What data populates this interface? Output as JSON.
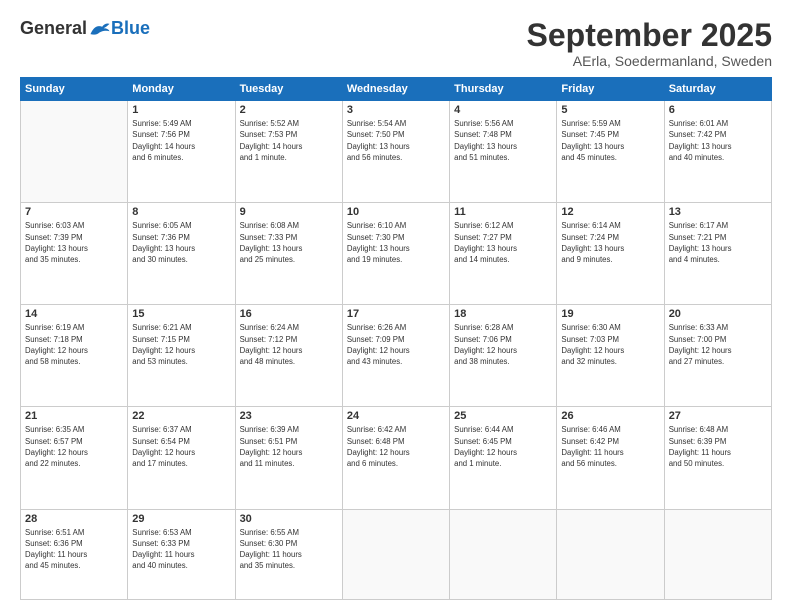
{
  "logo": {
    "general": "General",
    "blue": "Blue"
  },
  "header": {
    "month": "September 2025",
    "location": "AErla, Soedermanland, Sweden"
  },
  "days_of_week": [
    "Sunday",
    "Monday",
    "Tuesday",
    "Wednesday",
    "Thursday",
    "Friday",
    "Saturday"
  ],
  "weeks": [
    [
      {
        "day": "",
        "info": ""
      },
      {
        "day": "1",
        "info": "Sunrise: 5:49 AM\nSunset: 7:56 PM\nDaylight: 14 hours\nand 6 minutes."
      },
      {
        "day": "2",
        "info": "Sunrise: 5:52 AM\nSunset: 7:53 PM\nDaylight: 14 hours\nand 1 minute."
      },
      {
        "day": "3",
        "info": "Sunrise: 5:54 AM\nSunset: 7:50 PM\nDaylight: 13 hours\nand 56 minutes."
      },
      {
        "day": "4",
        "info": "Sunrise: 5:56 AM\nSunset: 7:48 PM\nDaylight: 13 hours\nand 51 minutes."
      },
      {
        "day": "5",
        "info": "Sunrise: 5:59 AM\nSunset: 7:45 PM\nDaylight: 13 hours\nand 45 minutes."
      },
      {
        "day": "6",
        "info": "Sunrise: 6:01 AM\nSunset: 7:42 PM\nDaylight: 13 hours\nand 40 minutes."
      }
    ],
    [
      {
        "day": "7",
        "info": "Sunrise: 6:03 AM\nSunset: 7:39 PM\nDaylight: 13 hours\nand 35 minutes."
      },
      {
        "day": "8",
        "info": "Sunrise: 6:05 AM\nSunset: 7:36 PM\nDaylight: 13 hours\nand 30 minutes."
      },
      {
        "day": "9",
        "info": "Sunrise: 6:08 AM\nSunset: 7:33 PM\nDaylight: 13 hours\nand 25 minutes."
      },
      {
        "day": "10",
        "info": "Sunrise: 6:10 AM\nSunset: 7:30 PM\nDaylight: 13 hours\nand 19 minutes."
      },
      {
        "day": "11",
        "info": "Sunrise: 6:12 AM\nSunset: 7:27 PM\nDaylight: 13 hours\nand 14 minutes."
      },
      {
        "day": "12",
        "info": "Sunrise: 6:14 AM\nSunset: 7:24 PM\nDaylight: 13 hours\nand 9 minutes."
      },
      {
        "day": "13",
        "info": "Sunrise: 6:17 AM\nSunset: 7:21 PM\nDaylight: 13 hours\nand 4 minutes."
      }
    ],
    [
      {
        "day": "14",
        "info": "Sunrise: 6:19 AM\nSunset: 7:18 PM\nDaylight: 12 hours\nand 58 minutes."
      },
      {
        "day": "15",
        "info": "Sunrise: 6:21 AM\nSunset: 7:15 PM\nDaylight: 12 hours\nand 53 minutes."
      },
      {
        "day": "16",
        "info": "Sunrise: 6:24 AM\nSunset: 7:12 PM\nDaylight: 12 hours\nand 48 minutes."
      },
      {
        "day": "17",
        "info": "Sunrise: 6:26 AM\nSunset: 7:09 PM\nDaylight: 12 hours\nand 43 minutes."
      },
      {
        "day": "18",
        "info": "Sunrise: 6:28 AM\nSunset: 7:06 PM\nDaylight: 12 hours\nand 38 minutes."
      },
      {
        "day": "19",
        "info": "Sunrise: 6:30 AM\nSunset: 7:03 PM\nDaylight: 12 hours\nand 32 minutes."
      },
      {
        "day": "20",
        "info": "Sunrise: 6:33 AM\nSunset: 7:00 PM\nDaylight: 12 hours\nand 27 minutes."
      }
    ],
    [
      {
        "day": "21",
        "info": "Sunrise: 6:35 AM\nSunset: 6:57 PM\nDaylight: 12 hours\nand 22 minutes."
      },
      {
        "day": "22",
        "info": "Sunrise: 6:37 AM\nSunset: 6:54 PM\nDaylight: 12 hours\nand 17 minutes."
      },
      {
        "day": "23",
        "info": "Sunrise: 6:39 AM\nSunset: 6:51 PM\nDaylight: 12 hours\nand 11 minutes."
      },
      {
        "day": "24",
        "info": "Sunrise: 6:42 AM\nSunset: 6:48 PM\nDaylight: 12 hours\nand 6 minutes."
      },
      {
        "day": "25",
        "info": "Sunrise: 6:44 AM\nSunset: 6:45 PM\nDaylight: 12 hours\nand 1 minute."
      },
      {
        "day": "26",
        "info": "Sunrise: 6:46 AM\nSunset: 6:42 PM\nDaylight: 11 hours\nand 56 minutes."
      },
      {
        "day": "27",
        "info": "Sunrise: 6:48 AM\nSunset: 6:39 PM\nDaylight: 11 hours\nand 50 minutes."
      }
    ],
    [
      {
        "day": "28",
        "info": "Sunrise: 6:51 AM\nSunset: 6:36 PM\nDaylight: 11 hours\nand 45 minutes."
      },
      {
        "day": "29",
        "info": "Sunrise: 6:53 AM\nSunset: 6:33 PM\nDaylight: 11 hours\nand 40 minutes."
      },
      {
        "day": "30",
        "info": "Sunrise: 6:55 AM\nSunset: 6:30 PM\nDaylight: 11 hours\nand 35 minutes."
      },
      {
        "day": "",
        "info": ""
      },
      {
        "day": "",
        "info": ""
      },
      {
        "day": "",
        "info": ""
      },
      {
        "day": "",
        "info": ""
      }
    ]
  ]
}
